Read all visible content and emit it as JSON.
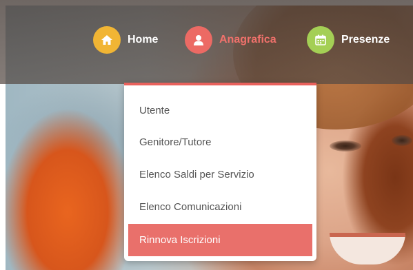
{
  "nav": {
    "items": [
      {
        "label": "Home",
        "icon": "home-icon",
        "color": "#f1b534"
      },
      {
        "label": "Anagrafica",
        "icon": "user-icon",
        "color": "#ec6a64",
        "active": true
      },
      {
        "label": "Presenze",
        "icon": "calendar-icon",
        "color": "#a4cf55"
      }
    ]
  },
  "dropdown": {
    "items": [
      {
        "label": "Utente"
      },
      {
        "label": "Genitore/Tutore"
      },
      {
        "label": "Elenco Saldi per Servizio"
      },
      {
        "label": "Elenco Comunicazioni"
      },
      {
        "label": "Rinnova Iscrizioni",
        "highlighted": true
      }
    ]
  },
  "colors": {
    "accent": "#e9615c",
    "highlight": "#e9706b"
  }
}
